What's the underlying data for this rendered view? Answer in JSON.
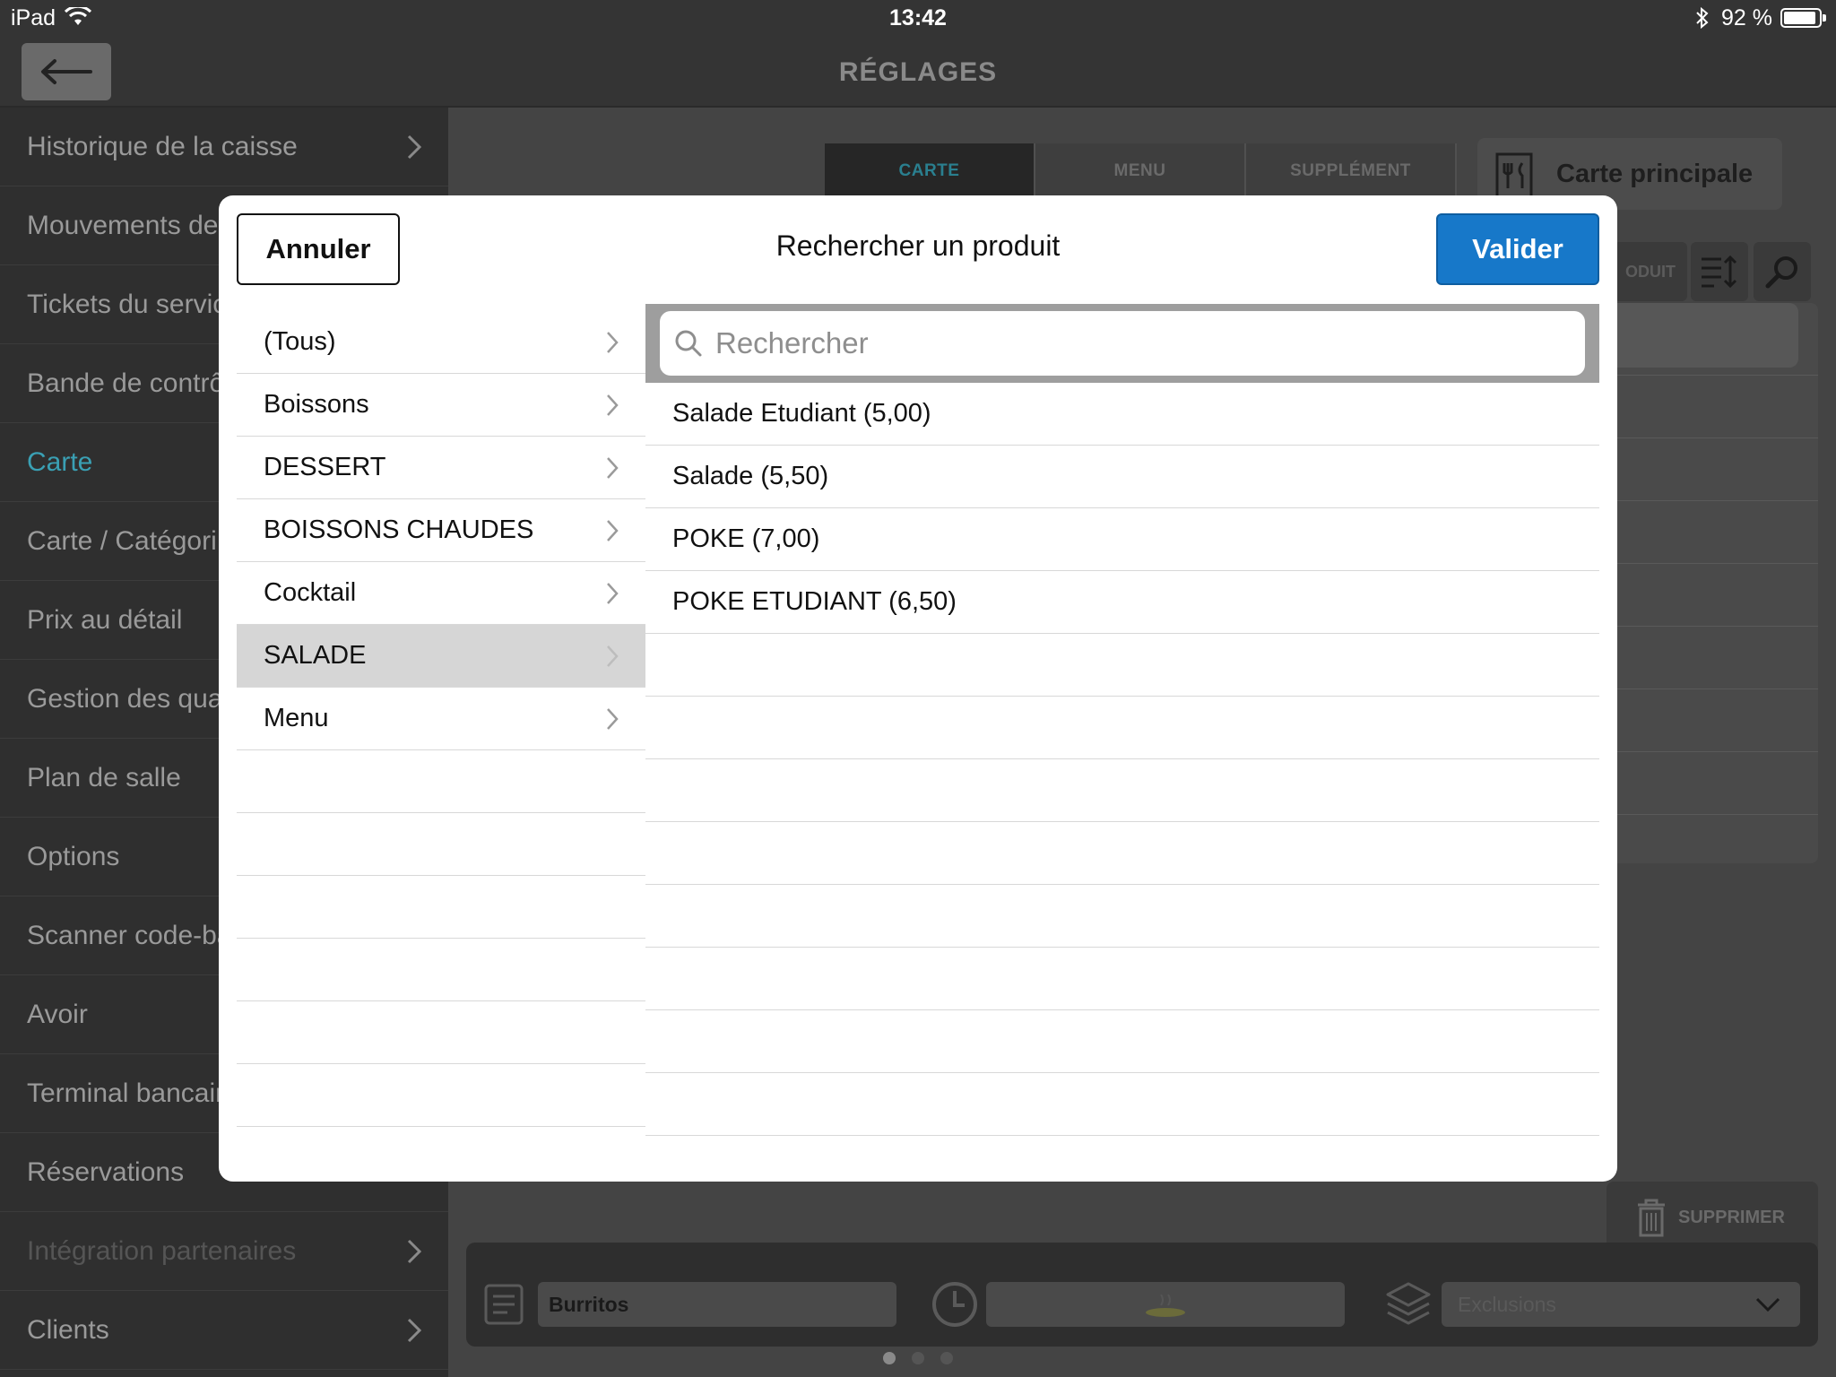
{
  "status_bar": {
    "device": "iPad",
    "time": "13:42",
    "battery": "92 %"
  },
  "nav": {
    "title": "RÉGLAGES"
  },
  "sidebar": {
    "items": [
      {
        "label": "Historique de la caisse",
        "chevron": true
      },
      {
        "label": "Mouvements de",
        "chevron": false
      },
      {
        "label": "Tickets du servic",
        "chevron": false
      },
      {
        "label": "Bande de contrô",
        "chevron": false
      },
      {
        "label": "Carte",
        "chevron": false,
        "active": true
      },
      {
        "label": "Carte / Catégori",
        "chevron": false
      },
      {
        "label": "Prix au détail",
        "chevron": false
      },
      {
        "label": "Gestion des qua",
        "chevron": false
      },
      {
        "label": "Plan de salle",
        "chevron": false
      },
      {
        "label": "Options",
        "chevron": false
      },
      {
        "label": "Scanner code-ba",
        "chevron": false
      },
      {
        "label": "Avoir",
        "chevron": false
      },
      {
        "label": "Terminal bancair",
        "chevron": false
      },
      {
        "label": "Réservations",
        "chevron": false
      },
      {
        "label": "Intégration partenaires",
        "chevron": true,
        "disabled": true
      },
      {
        "label": "Clients",
        "chevron": true
      }
    ]
  },
  "main": {
    "tabs": [
      {
        "label": "CARTE",
        "active": true
      },
      {
        "label": "MENU"
      },
      {
        "label": "SUPPLÉMENT"
      }
    ],
    "carte_selector": "Carte principale",
    "product_button": "ODUIT",
    "delete_label": "SUPPRIMER",
    "bottom": {
      "name_value": "Burritos",
      "exclusions_placeholder": "Exclusions"
    }
  },
  "modal": {
    "title": "Rechercher un produit",
    "cancel_label": "Annuler",
    "confirm_label": "Valider",
    "search_placeholder": "Rechercher",
    "categories": [
      {
        "label": "(Tous)"
      },
      {
        "label": "Boissons"
      },
      {
        "label": "DESSERT"
      },
      {
        "label": "BOISSONS CHAUDES"
      },
      {
        "label": "Cocktail"
      },
      {
        "label": "SALADE",
        "selected": true
      },
      {
        "label": "Menu"
      }
    ],
    "products": [
      {
        "label": "Salade Etudiant (5,00)"
      },
      {
        "label": "Salade (5,50)"
      },
      {
        "label": "POKE (7,00)"
      },
      {
        "label": "POKE ETUDIANT (6,50)"
      }
    ]
  },
  "colors": {
    "accent": "#1778c9",
    "active_sidebar": "#3aa0b4",
    "selected_row": "#d6d6d6"
  },
  "icons": [
    "wifi-icon",
    "bluetooth-icon",
    "battery-icon",
    "back-arrow-icon",
    "chevron-right-icon",
    "menu-card-icon",
    "sort-icon",
    "search-icon",
    "trash-icon",
    "note-icon",
    "clock-icon",
    "dish-icon",
    "layers-icon",
    "dropdown-chevron-icon"
  ]
}
